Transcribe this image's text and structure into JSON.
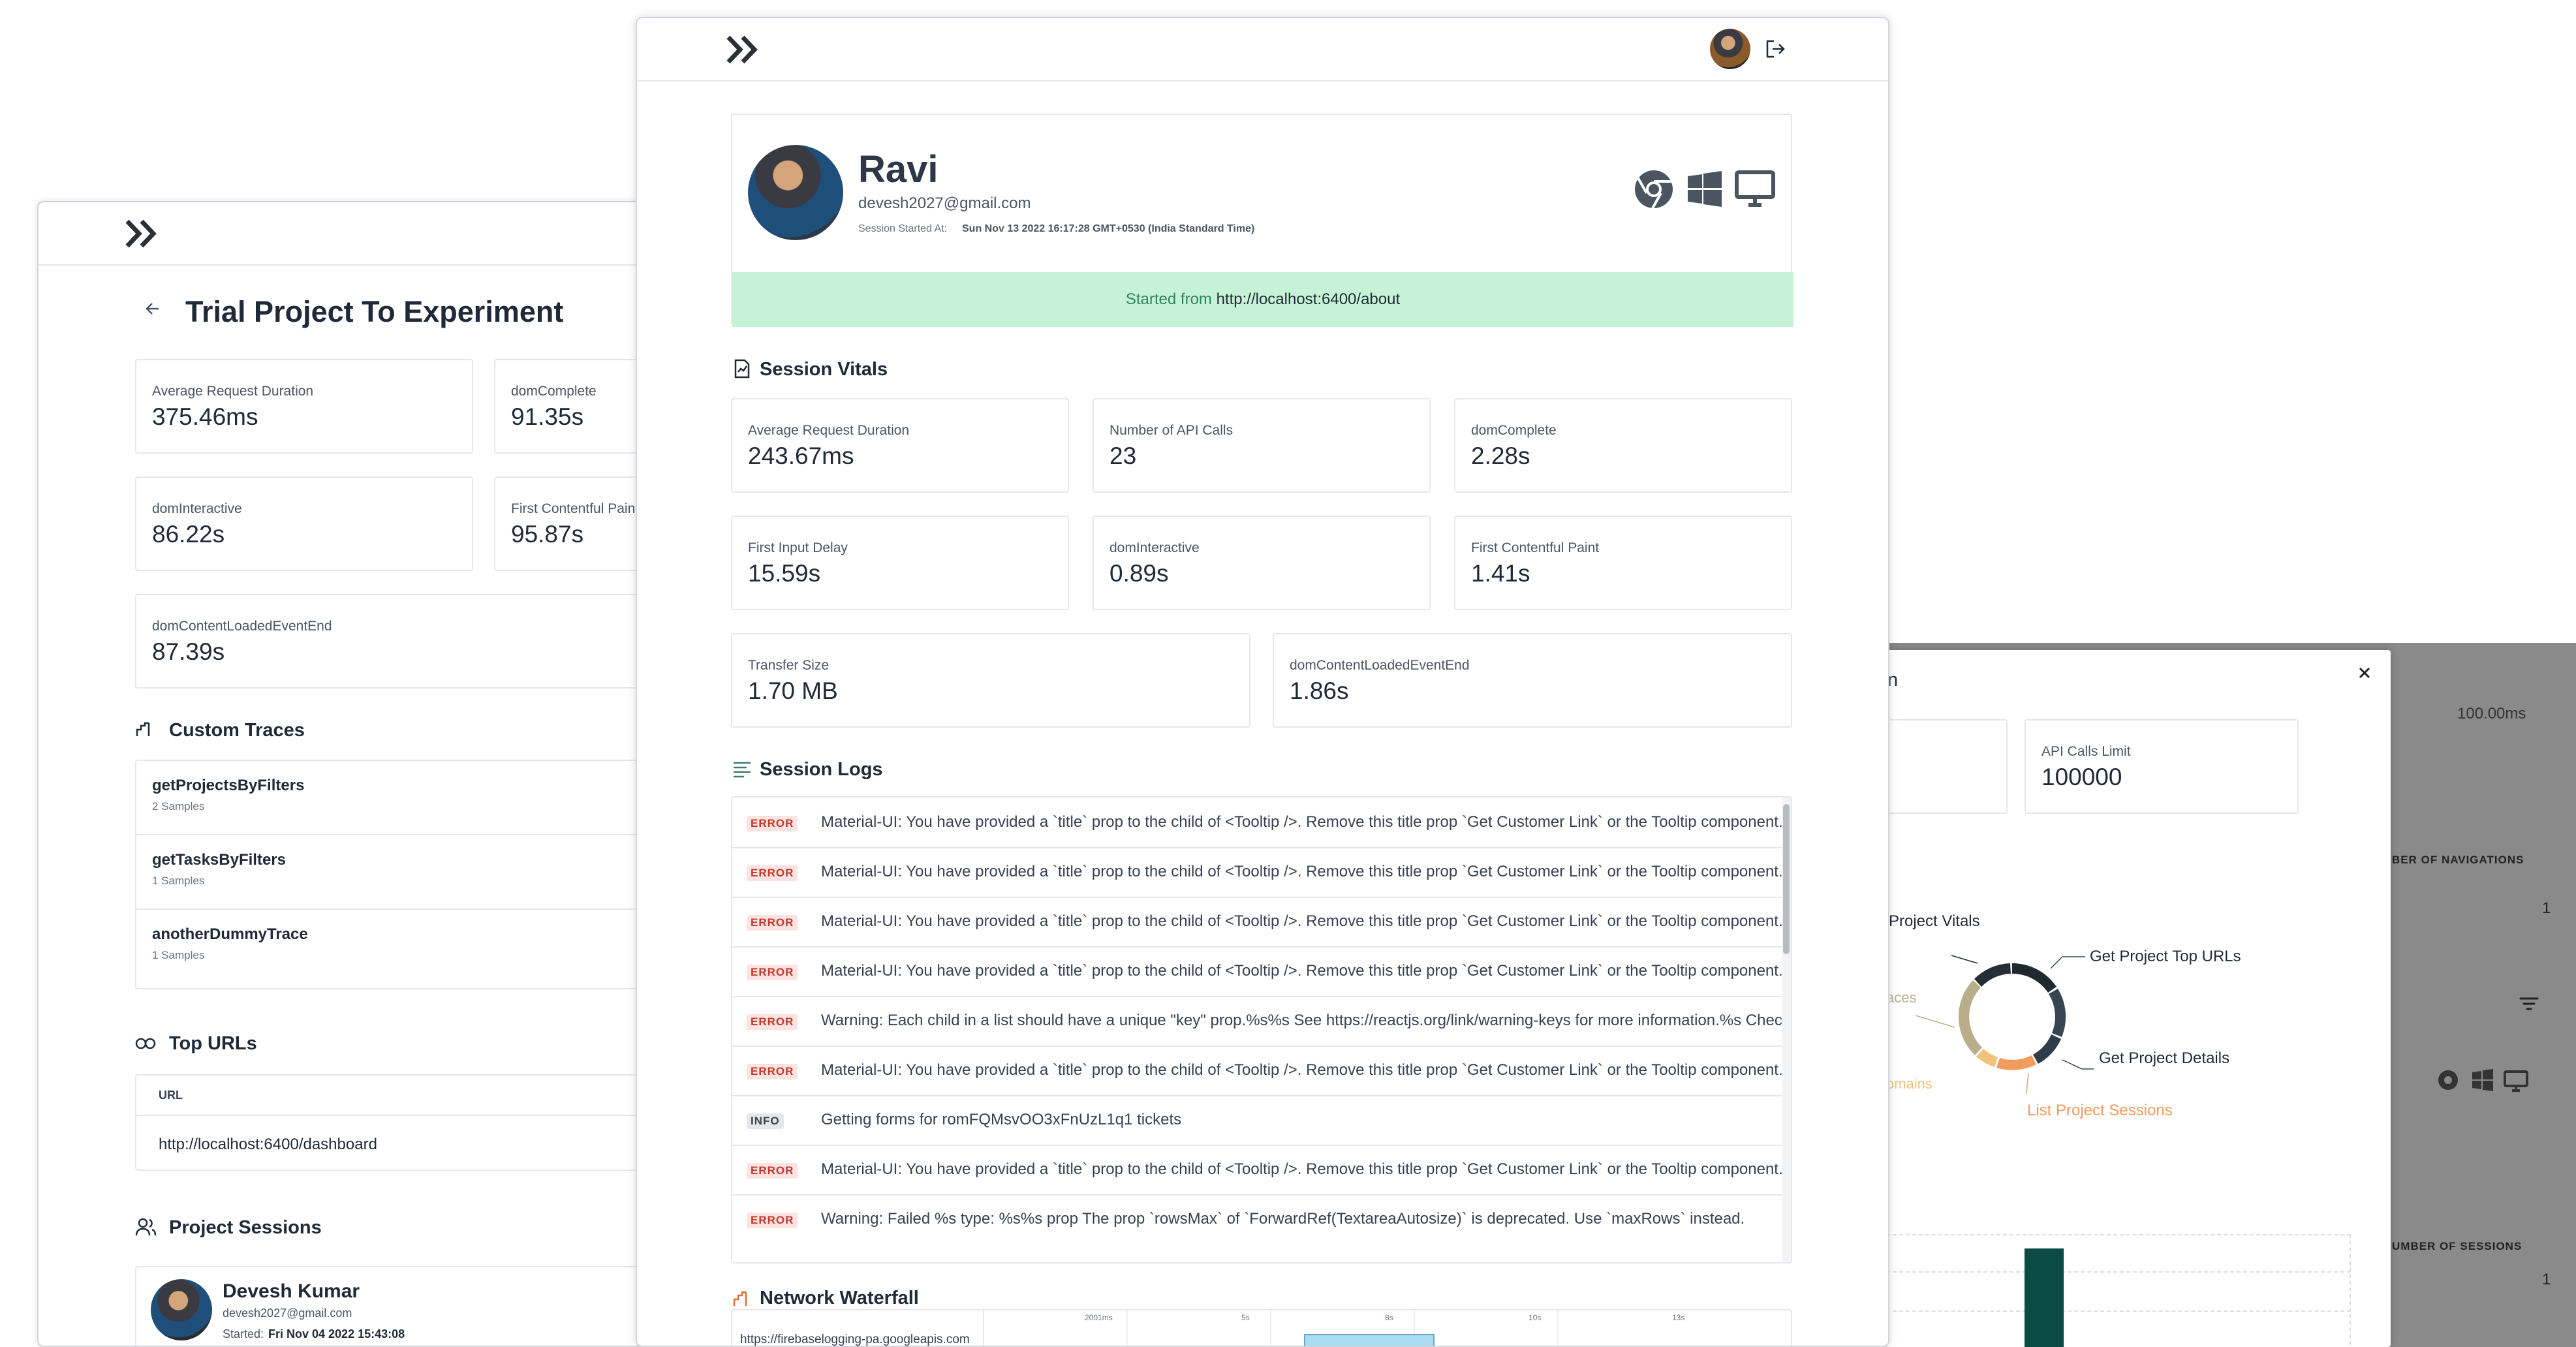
{
  "left_window": {
    "project_title": "Trial Project To Experiment",
    "stats": [
      {
        "label": "Average Request Duration",
        "value": "375.46ms"
      },
      {
        "label": "domComplete",
        "value": "91.35s"
      },
      {
        "label": "domInteractive",
        "value": "86.22s"
      },
      {
        "label": "First Contentful Pain",
        "value": "95.87s"
      },
      {
        "label": "domContentLoadedEventEnd",
        "value": "87.39s"
      }
    ],
    "custom_traces_title": "Custom Traces",
    "traces": [
      {
        "name": "getProjectsByFilters",
        "samples": "2 Samples"
      },
      {
        "name": "getTasksByFilters",
        "samples": "1 Samples"
      },
      {
        "name": "anotherDummyTrace",
        "samples": "1 Samples"
      }
    ],
    "top_urls_title": "Top URLs",
    "url_header": "URL",
    "urls": [
      "http://localhost:6400/dashboard"
    ],
    "project_sessions_title": "Project Sessions",
    "session": {
      "name": "Devesh Kumar",
      "email": "devesh2027@gmail.com",
      "started_label": "Started:",
      "started_value": "Fri Nov 04 2022 15:43:08"
    }
  },
  "main_window": {
    "user": {
      "name": "Ravi",
      "email": "devesh2027@gmail.com",
      "session_started_label": "Session Started At:",
      "session_started_value": "Sun Nov 13 2022 16:17:28 GMT+0530 (India Standard Time)"
    },
    "banner": {
      "prefix": "Started from",
      "url": "http://localhost:6400/about"
    },
    "vitals_title": "Session Vitals",
    "vitals": [
      {
        "label": "Average Request Duration",
        "value": "243.67ms"
      },
      {
        "label": "Number of API Calls",
        "value": "23"
      },
      {
        "label": "domComplete",
        "value": "2.28s"
      },
      {
        "label": "First Input Delay",
        "value": "15.59s"
      },
      {
        "label": "domInteractive",
        "value": "0.89s"
      },
      {
        "label": "First Contentful Paint",
        "value": "1.41s"
      },
      {
        "label": "Transfer Size",
        "value": "1.70 MB"
      },
      {
        "label": "domContentLoadedEventEnd",
        "value": "1.86s"
      }
    ],
    "logs_title": "Session Logs",
    "logs": [
      {
        "level": "ERROR",
        "message": "Material-UI: You have provided a `title` prop to the child of <Tooltip />. Remove this title prop `Get Customer Link` or the Tooltip component."
      },
      {
        "level": "ERROR",
        "message": "Material-UI: You have provided a `title` prop to the child of <Tooltip />. Remove this title prop `Get Customer Link` or the Tooltip component."
      },
      {
        "level": "ERROR",
        "message": "Material-UI: You have provided a `title` prop to the child of <Tooltip />. Remove this title prop `Get Customer Link` or the Tooltip component."
      },
      {
        "level": "ERROR",
        "message": "Material-UI: You have provided a `title` prop to the child of <Tooltip />. Remove this title prop `Get Customer Link` or the Tooltip component."
      },
      {
        "level": "ERROR",
        "message": "Warning: Each child in a list should have a unique \"key\" prop.%s%s See https://reactjs.org/link/warning-keys for more information.%s   Check"
      },
      {
        "level": "ERROR",
        "message": "Material-UI: You have provided a `title` prop to the child of <Tooltip />. Remove this title prop `Get Customer Link` or the Tooltip component."
      },
      {
        "level": "INFO",
        "message": "Getting forms for   romFQMsvOO3xFnUzL1q1   tickets"
      },
      {
        "level": "ERROR",
        "message": "Material-UI: You have provided a `title` prop to the child of <Tooltip />. Remove this title prop `Get Customer Link` or the Tooltip component."
      },
      {
        "level": "ERROR",
        "message": "Warning: Failed %s type: %s%s   prop   The prop `rowsMax` of `ForwardRef(TextareaAutosize)` is deprecated. Use `maxRows` instead."
      }
    ],
    "waterfall_title": "Network Waterfall",
    "waterfall_url": "https://firebaselogging-pa.googleapis.com",
    "waterfall_ticks": [
      "2001ms",
      "5s",
      "8s",
      "10s",
      "13s"
    ]
  },
  "right_window": {
    "title_fragment": "n",
    "api_calls_limit_label": "API Calls Limit",
    "api_calls_limit_value": "100000",
    "donut_labels": [
      "Project Vitals",
      "Get Project Top URLs",
      "Get Project Details",
      "List Project Sessions",
      "omains",
      "aces"
    ],
    "colors": {
      "dark": "#1f2a30",
      "slate": "#364550",
      "sand": "#b9ae8c",
      "peach": "#f0c27b",
      "orange": "#f39b5e",
      "bar": "#0b4a45"
    }
  },
  "far_right": {
    "value_top": "100.00ms",
    "header_navigations": "BER OF NAVIGATIONS",
    "navigations_value": "1",
    "header_sessions": "UMBER OF SESSIONS",
    "sessions_value": "1"
  },
  "icons": {
    "logo": "chevrons-right-icon",
    "logout": "logout-icon",
    "chrome": "chrome-icon",
    "windows": "windows-icon",
    "desktop": "desktop-icon"
  }
}
